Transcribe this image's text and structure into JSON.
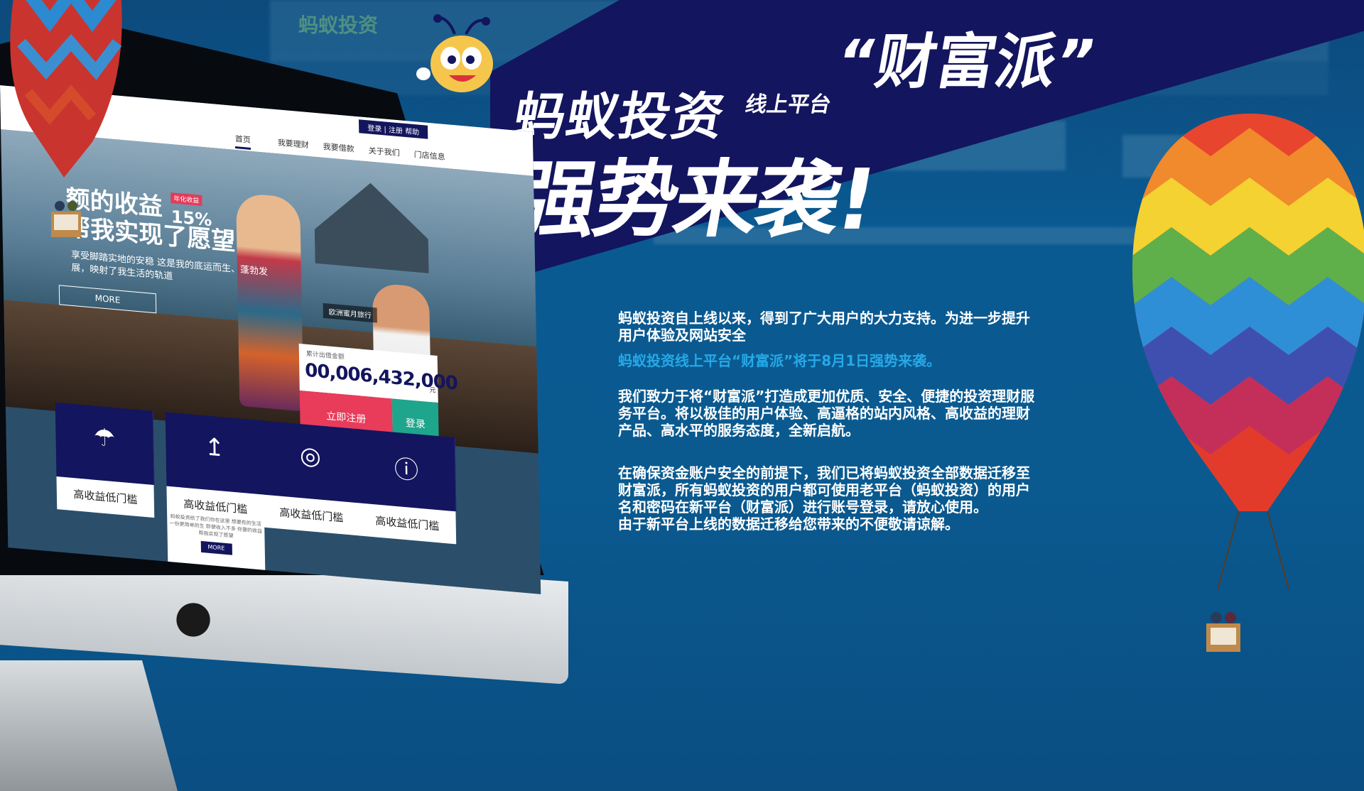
{
  "background_site": {
    "logo_text": "蚂蚁投资"
  },
  "banner": {
    "title_main": "蚂蚁投资",
    "title_sub": "线上平台",
    "title_brand": "“财富派”",
    "title_second": "强势来袭!"
  },
  "announcement": {
    "paragraph_1": "蚂蚁投资自上线以来，得到了广大用户的大力支持。为进一步提升用户体验及网站安全",
    "highlight": "蚂蚁投资线上平台“财富派”将于8月1日强势来袭。",
    "paragraph_2": "我们致力于将“财富派”打造成更加优质、安全、便捷的投资理财服务平台。将以极佳的用户体验、高逼格的站内风格、高收益的理财产品、高水平的服务态度，全新启航。",
    "paragraph_3": "在确保资金账户安全的前提下，我们已将蚂蚁投资全部数据迁移至财富派，所有蚂蚁投资的用户都可使用老平台（蚂蚁投资）的用户名和密码在新平台（财富派）进行账号登录，请放心使用。",
    "paragraph_4": "由于新平台上线的数据迁移给您带来的不便敬请谅解。"
  },
  "screen_site": {
    "top_info": "登录 | 注册   帮助",
    "nav": [
      {
        "label": "首页",
        "active": true
      },
      {
        "label": "我要理财"
      },
      {
        "label": "我要借款"
      },
      {
        "label": "关于我们"
      },
      {
        "label": "门店信息"
      }
    ],
    "hero": {
      "headline_1": "额的收益",
      "headline_2": "帮我实现了愿望",
      "badge": "年化收益",
      "rate": "15%",
      "subtext": "享受脚踏实地的安稳 这是我的底运而生、蓬勃发展，映射了我生活的轨道",
      "more": "MORE",
      "tag": "欧洲蜜月旅行"
    },
    "counter": {
      "label": "累计出借金额",
      "value": "00,006,432,000",
      "unit": "元"
    },
    "register_button": "立即注册",
    "login_button": "登录",
    "features": [
      {
        "icon": "umbrella-icon",
        "label": "高收益低门槛"
      },
      {
        "icon": "chart-icon",
        "label": "高收益低门槛"
      },
      {
        "icon": "globe-icon",
        "label": "高收益低门槛"
      },
      {
        "icon": "info-icon",
        "label": "高收益低门槛"
      }
    ],
    "feature_card_desc": "蚂蚁投资给了我们你在这里 想要有的生活 一份更简单的生 即便收入不多 你要的收益帮我实现了愿望",
    "feature_card_more": "MORE"
  },
  "device": {
    "brand_icon": "apple-logo-icon"
  },
  "colors": {
    "banner_navy": "#13155e",
    "highlight_blue": "#26a9e8",
    "background_blue": "#0a5a90"
  }
}
